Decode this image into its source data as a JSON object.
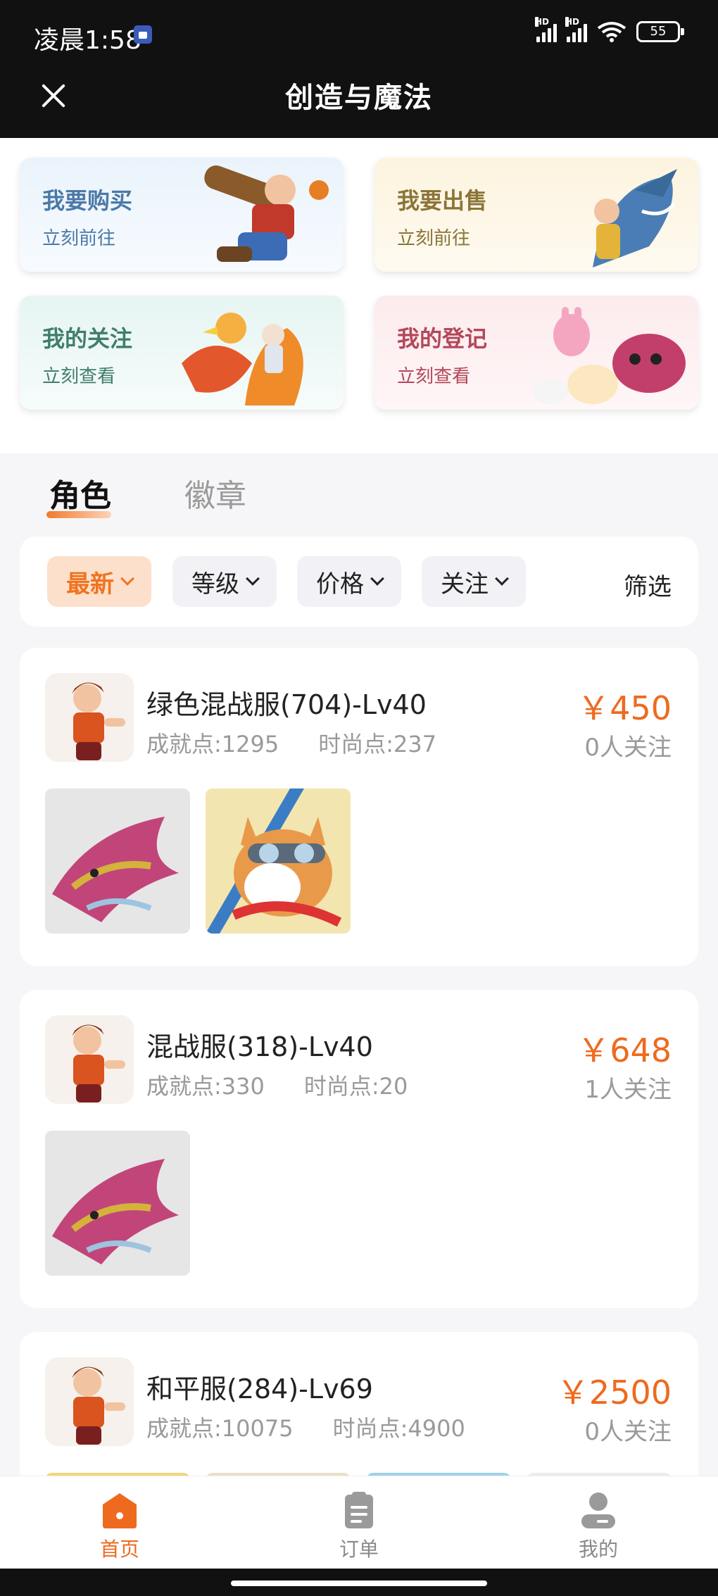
{
  "status_bar": {
    "time": "凌晨1:58",
    "network1": "HD",
    "network2": "HD",
    "battery": "55"
  },
  "header": {
    "title": "创造与魔法"
  },
  "quick_links": [
    {
      "title": "我要购买",
      "action": "立刻前往"
    },
    {
      "title": "我要出售",
      "action": "立刻前往"
    },
    {
      "title": "我的关注",
      "action": "立刻查看"
    },
    {
      "title": "我的登记",
      "action": "立刻查看"
    }
  ],
  "tabs": [
    {
      "label": "角色",
      "active": true
    },
    {
      "label": "徽章",
      "active": false
    }
  ],
  "filters": {
    "buttons": [
      {
        "label": "最新",
        "active": true
      },
      {
        "label": "等级",
        "active": false
      },
      {
        "label": "价格",
        "active": false
      },
      {
        "label": "关注",
        "active": false
      }
    ],
    "screen_label": "筛选"
  },
  "listings": [
    {
      "name": "绿色混战服(704)-Lv40",
      "achievement": "成就点:1295",
      "fashion": "时尚点:237",
      "price": "￥450",
      "followers": "0人关注",
      "thumbnails": [
        "dragon-mount",
        "corgi-pilot"
      ]
    },
    {
      "name": "混战服(318)-Lv40",
      "achievement": "成就点:330",
      "fashion": "时尚点:20",
      "price": "￥648",
      "followers": "1人关注",
      "thumbnails": [
        "dragon-mount"
      ]
    },
    {
      "name": "和平服(284)-Lv69",
      "achievement": "成就点:10075",
      "fashion": "时尚点:4900",
      "price": "￥2500",
      "followers": "0人关注",
      "thumbnails": [
        "pet-1",
        "pet-2",
        "pet-3",
        "pet-4"
      ]
    }
  ],
  "bottom_nav": [
    {
      "label": "首页",
      "icon": "home-icon",
      "active": true
    },
    {
      "label": "订单",
      "icon": "order-icon",
      "active": false
    },
    {
      "label": "我的",
      "icon": "user-icon",
      "active": false
    }
  ],
  "colors": {
    "accent": "#ee6a1f",
    "header_bg": "#111111",
    "page_bg": "#f6f6f8"
  }
}
